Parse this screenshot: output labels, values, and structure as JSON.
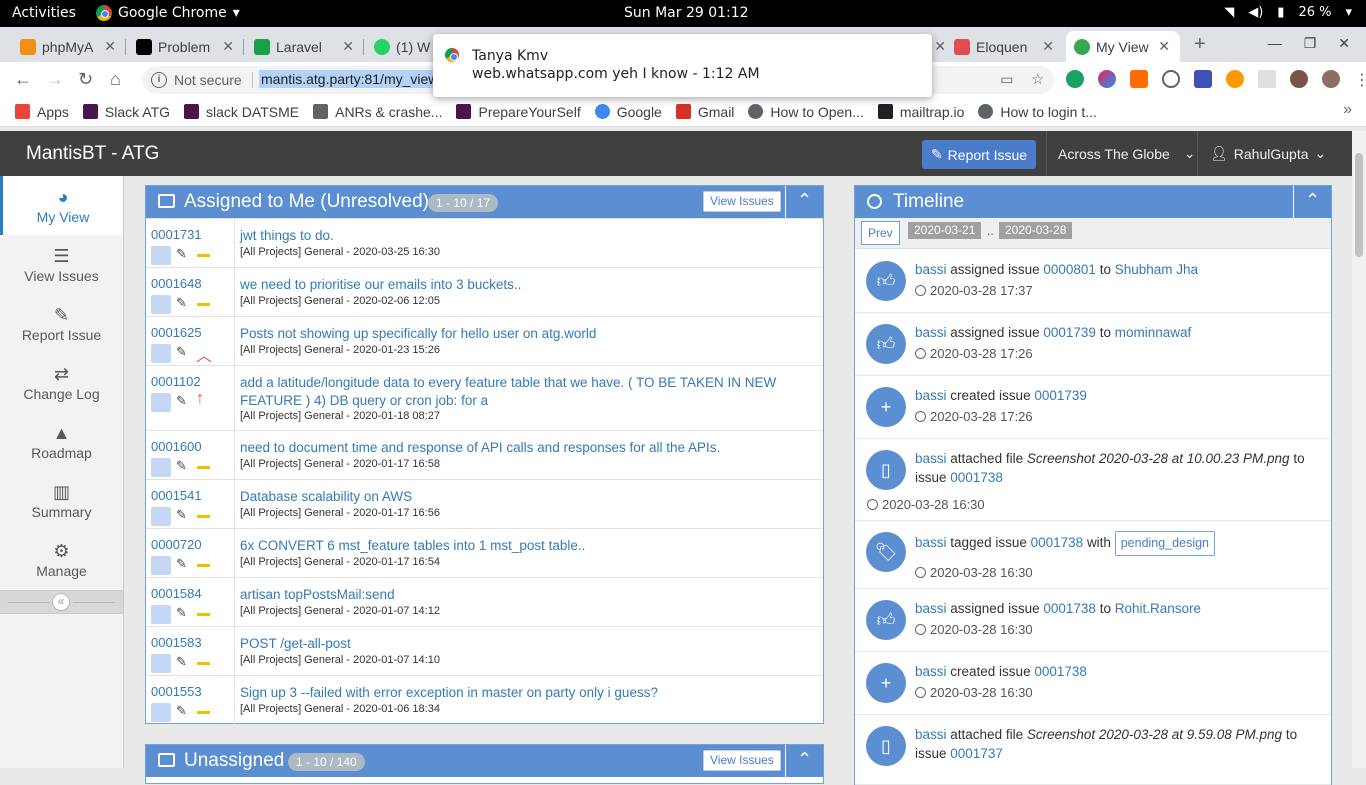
{
  "system": {
    "activities": "Activities",
    "app_name": "Google Chrome",
    "clock": "Sun Mar 29  01:12",
    "battery": "26 %"
  },
  "tabs": [
    {
      "label": "phpMyA",
      "favicon_color": "#f29111"
    },
    {
      "label": "Problem",
      "favicon_color": "#000000"
    },
    {
      "label": "Laravel",
      "favicon_color": "#1a9f4b"
    },
    {
      "label": "(1) W",
      "favicon_color": "#25d366"
    },
    {
      "label": "Eloquen",
      "favicon_color": "#e34c4c"
    },
    {
      "label": "My View",
      "favicon_color": "#34a853"
    }
  ],
  "toolbar": {
    "not_secure": "Not secure",
    "url": "mantis.atg.party:81/my_view"
  },
  "bookmarks": [
    {
      "label": "Apps",
      "icon_color": "#e8453c"
    },
    {
      "label": "Slack ATG",
      "icon_color": "#4a154b"
    },
    {
      "label": "slack DATSME",
      "icon_color": "#4a154b"
    },
    {
      "label": "ANRs & crashe...",
      "icon_color": "#5f6368"
    },
    {
      "label": "PrepareYourSelf",
      "icon_color": "#4a154b"
    },
    {
      "label": "Google",
      "icon_color": "#4285f4"
    },
    {
      "label": "Gmail",
      "icon_color": "#d93025"
    },
    {
      "label": "How to Open...",
      "icon_color": "#5f6368"
    },
    {
      "label": "mailtrap.io",
      "icon_color": "#202124"
    },
    {
      "label": "How to login t...",
      "icon_color": "#5f6368"
    }
  ],
  "notification": {
    "title": "Tanya Kmv",
    "body": "web.whatsapp.com  yeh I know - 1:12 AM"
  },
  "navbar": {
    "brand": "MantisBT - ATG",
    "report_issue": "Report Issue",
    "project": "Across The Globe",
    "user": "RahulGupta"
  },
  "sidebar": {
    "items": [
      {
        "label": "My View",
        "icon": "dashboard-icon"
      },
      {
        "label": "View Issues",
        "icon": "list-icon"
      },
      {
        "label": "Report Issue",
        "icon": "edit-icon"
      },
      {
        "label": "Change Log",
        "icon": "retweet-icon"
      },
      {
        "label": "Roadmap",
        "icon": "road-icon"
      },
      {
        "label": "Summary",
        "icon": "bar-chart-icon"
      },
      {
        "label": "Manage",
        "icon": "gears-icon"
      }
    ]
  },
  "assigned": {
    "title": "Assigned to Me (Unresolved)",
    "badge": "1 - 10 / 17",
    "view_issues": "View Issues",
    "issues": [
      {
        "id": "0001731",
        "summary": "jwt things to do.",
        "meta": "[All Projects] General - 2020-03-25 16:30",
        "priority": "normal"
      },
      {
        "id": "0001648",
        "summary": "we need to prioritise our emails into 3 buckets..",
        "meta": "[All Projects] General - 2020-02-06 12:05",
        "priority": "normal"
      },
      {
        "id": "0001625",
        "summary": "Posts not showing up specifically for hello user on atg.world",
        "meta": "[All Projects] General - 2020-01-23 15:26",
        "priority": "high"
      },
      {
        "id": "0001102",
        "summary": "add a latitude/longitude data to every feature table that we have. ( TO BE TAKEN IN NEW FEATURE ) 4) DB query or cron job: for a",
        "meta": "[All Projects] General - 2020-01-18 08:27",
        "priority": "urgent"
      },
      {
        "id": "0001600",
        "summary": "need to document time and response of API calls and responses for all the APIs.",
        "meta": "[All Projects] General - 2020-01-17 16:58",
        "priority": "normal"
      },
      {
        "id": "0001541",
        "summary": "Database scalability on AWS",
        "meta": "[All Projects] General - 2020-01-17 16:56",
        "priority": "normal"
      },
      {
        "id": "0000720",
        "summary": "6x CONVERT 6 mst_feature tables into 1 mst_post table..",
        "meta": "[All Projects] General - 2020-01-17 16:54",
        "priority": "normal"
      },
      {
        "id": "0001584",
        "summary": "artisan topPostsMail:send",
        "meta": "[All Projects] General - 2020-01-07 14:12",
        "priority": "normal"
      },
      {
        "id": "0001583",
        "summary": "POST /get-all-post",
        "meta": "[All Projects] General - 2020-01-07 14:10",
        "priority": "normal"
      },
      {
        "id": "0001553",
        "summary": "Sign up 3 --failed with error exception in master on party only i guess?",
        "meta": "[All Projects] General - 2020-01-06 18:34",
        "priority": "normal"
      }
    ]
  },
  "unassigned": {
    "title": "Unassigned",
    "badge": "1 - 10 / 140",
    "view_issues": "View Issues"
  },
  "timeline": {
    "title": "Timeline",
    "prev": "Prev",
    "date_from": "2020-03-21",
    "dots": "..",
    "date_to": "2020-03-28",
    "events": [
      {
        "user": "bassi",
        "action": "assigned issue",
        "issue": "0000801",
        "prep": "to",
        "target": "Shubham Jha",
        "time": "2020-03-28 17:37",
        "icon": "thumbs-up-icon"
      },
      {
        "user": "bassi",
        "action": "assigned issue",
        "issue": "0001739",
        "prep": "to",
        "target": "mominnawaf",
        "time": "2020-03-28 17:26",
        "icon": "thumbs-up-icon"
      },
      {
        "user": "bassi",
        "action": "created issue",
        "issue": "0001739",
        "time": "2020-03-28 17:26",
        "icon": "plus-icon"
      },
      {
        "user": "bassi",
        "action": "attached file",
        "file": "Screenshot 2020-03-28 at 10.00.23 PM.png",
        "prep": "to",
        "issue_label": "issue",
        "issue": "0001738",
        "time": "2020-03-28 16:30",
        "icon": "file-icon"
      },
      {
        "user": "bassi",
        "action": "tagged issue",
        "issue": "0001738",
        "prep": "with",
        "tag": "pending_design",
        "time": "2020-03-28 16:30",
        "icon": "tag-icon"
      },
      {
        "user": "bassi",
        "action": "assigned issue",
        "issue": "0001738",
        "prep": "to",
        "target": "Rohit.Ransore",
        "time": "2020-03-28 16:30",
        "icon": "thumbs-up-icon"
      },
      {
        "user": "bassi",
        "action": "created issue",
        "issue": "0001738",
        "time": "2020-03-28 16:30",
        "icon": "plus-icon"
      },
      {
        "user": "bassi",
        "action": "attached file",
        "file": "Screenshot 2020-03-28 at 9.59.08 PM.png",
        "prep": "to",
        "issue_label": "issue",
        "issue": "0001737",
        "icon": "file-icon"
      }
    ]
  },
  "colors": {
    "accent": "#5b8fd1",
    "navbar": "#404040",
    "link": "#337ab7"
  }
}
